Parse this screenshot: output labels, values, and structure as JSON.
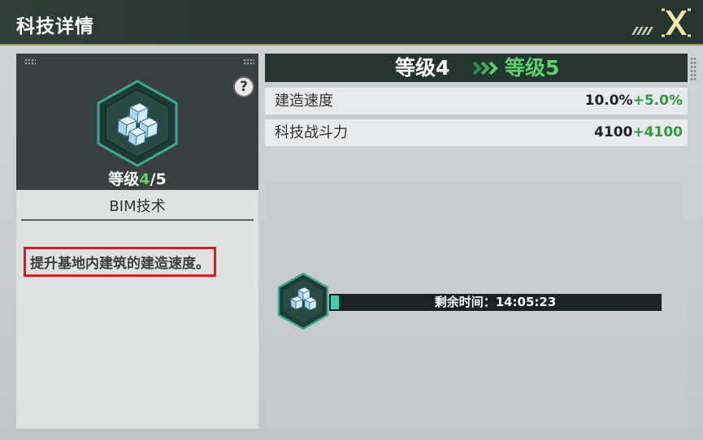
{
  "window": {
    "title": "科技详情",
    "close_label": "X",
    "close_icon": "close-x-icon"
  },
  "tech": {
    "icon": "cube-cluster-icon",
    "level_prefix": "等级",
    "level_current": "4",
    "level_max": "/5",
    "name": "BIM技术",
    "description": "提升基地内建筑的建造速度。",
    "help_label": "?"
  },
  "upgrade": {
    "from_label": "等级4",
    "arrow_icon": "chevron-arrows-right-icon",
    "to_label": "等级5",
    "stats": [
      {
        "label": "建造速度",
        "value": "10.0%",
        "bonus": "+5.0%"
      },
      {
        "label": "科技战斗力",
        "value": "4100",
        "bonus": "+4100"
      }
    ]
  },
  "timer": {
    "icon": "cube-cluster-icon",
    "text": "剩余时间：14:05:23",
    "progress": 0.02
  },
  "colors": {
    "header_bg": "#263631",
    "accent_green": "#5bd36a",
    "bonus_green": "#2f9a3e",
    "progress_teal": "#3ccfb3",
    "highlight_red": "#d21e1e"
  }
}
